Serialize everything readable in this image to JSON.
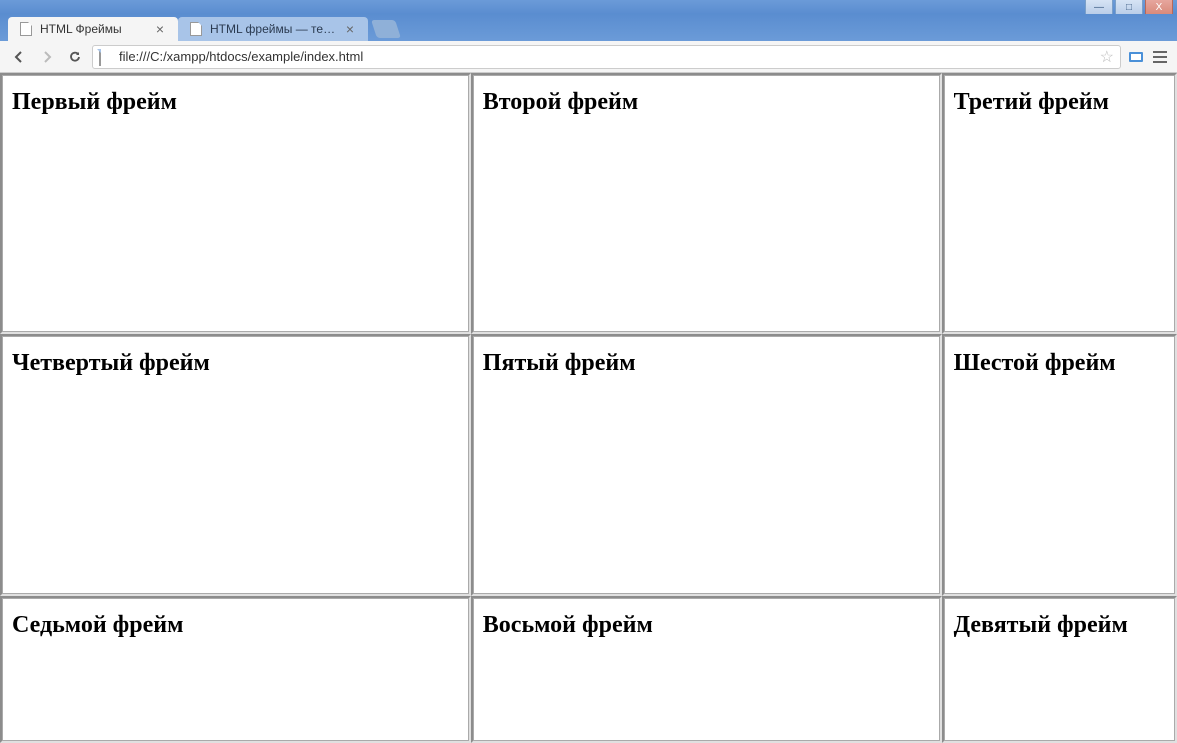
{
  "window": {
    "minimize": "—",
    "maximize": "□",
    "close": "X"
  },
  "tabs": [
    {
      "title": "HTML Фреймы",
      "active": true
    },
    {
      "title": "HTML фреймы — тег fram",
      "active": false
    }
  ],
  "address": {
    "url": "file:///C:/xampp/htdocs/example/index.html"
  },
  "frames": [
    {
      "heading": "Первый фрейм"
    },
    {
      "heading": "Второй фрейм"
    },
    {
      "heading": "Третий фрейм"
    },
    {
      "heading": "Четвертый фрейм"
    },
    {
      "heading": "Пятый фрейм"
    },
    {
      "heading": "Шестой фрейм"
    },
    {
      "heading": "Седьмой фрейм"
    },
    {
      "heading": "Восьмой фрейм"
    },
    {
      "heading": "Девятый фрейм"
    }
  ]
}
